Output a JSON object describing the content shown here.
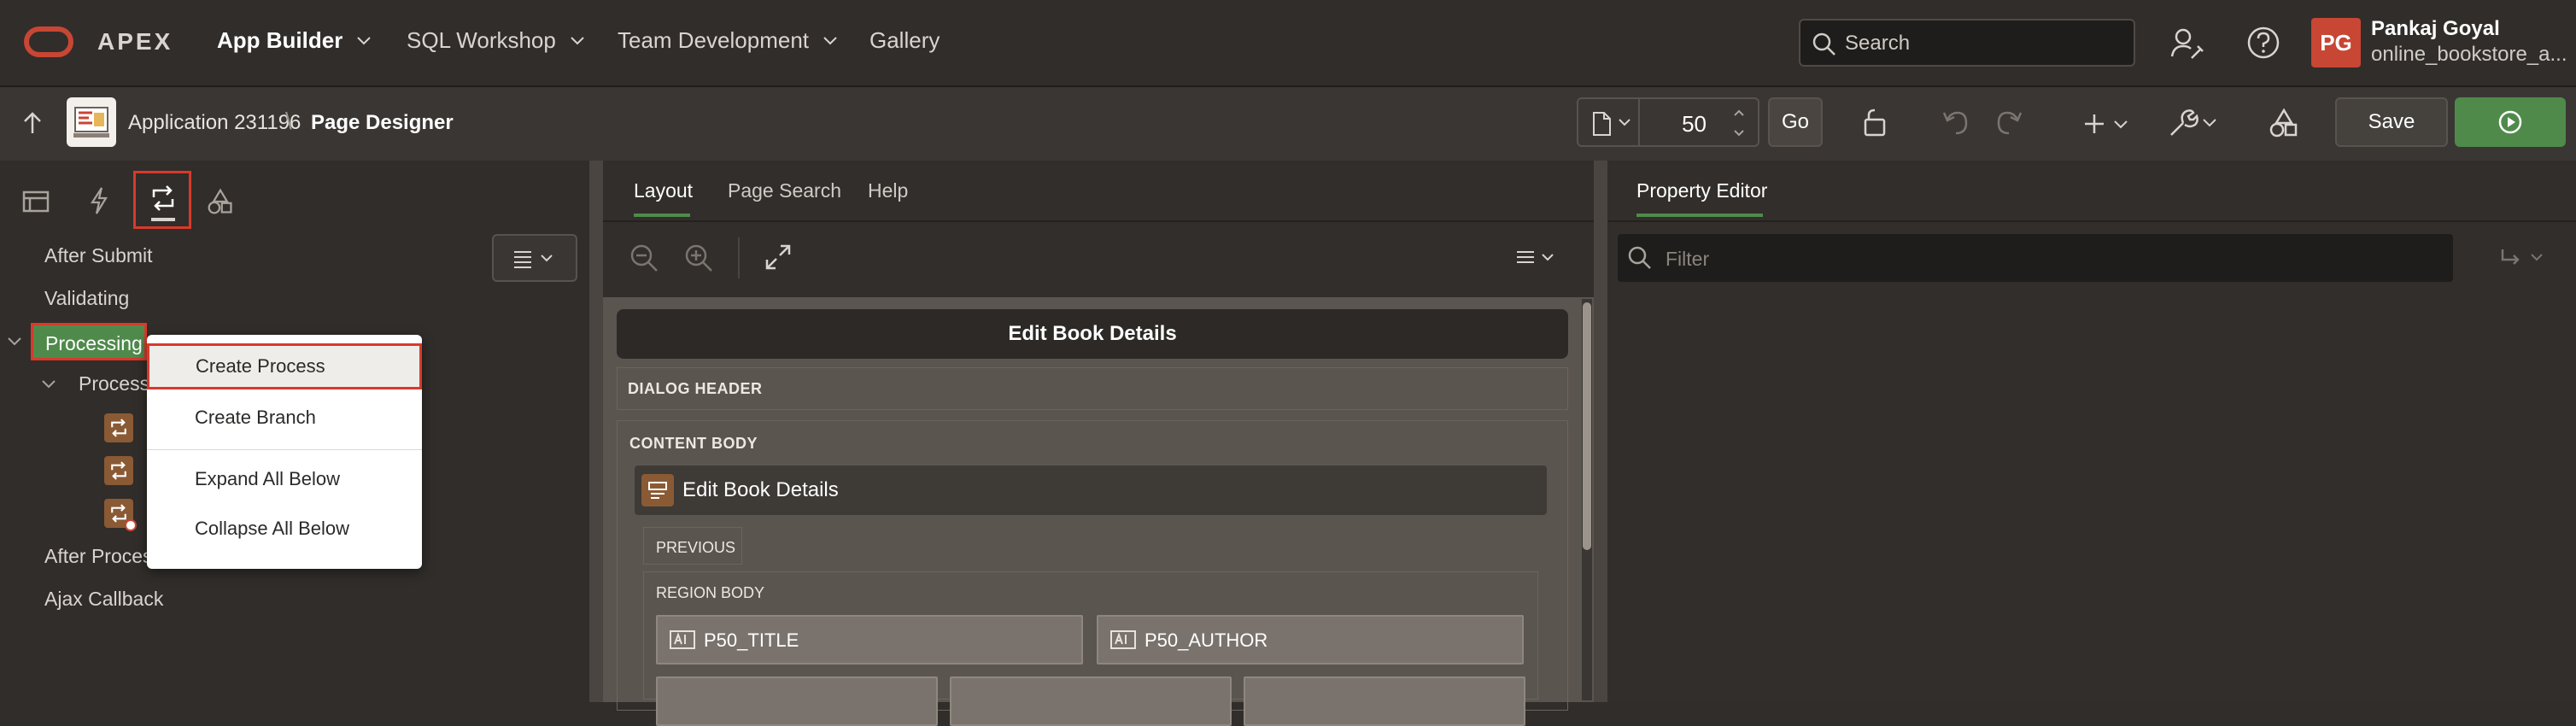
{
  "topnav": {
    "brand": "APEX",
    "items": [
      {
        "label": "App Builder",
        "active": true
      },
      {
        "label": "SQL Workshop"
      },
      {
        "label": "Team Development"
      },
      {
        "label": "Gallery"
      }
    ],
    "search_placeholder": "Search",
    "user": {
      "initials": "PG",
      "name": "Pankaj Goyal",
      "workspace": "online_bookstore_a..."
    }
  },
  "toolbar": {
    "app_label": "Application 231196",
    "separator": "\\",
    "page_label": "Page Designer",
    "page_number": "50",
    "go_label": "Go",
    "save_label": "Save"
  },
  "left_panel": {
    "menu_button_icon": "hamburger-icon",
    "tree": {
      "after_submit": "After Submit",
      "validating": "Validating",
      "processing": "Processing",
      "processes": "Processes",
      "after_processing": "After Processing",
      "ajax_callback": "Ajax Callback"
    }
  },
  "context_menu": {
    "items": [
      "Create Process",
      "Create Branch",
      "Expand All Below",
      "Collapse All Below"
    ]
  },
  "layout_panel": {
    "tabs": [
      {
        "label": "Layout",
        "active": true
      },
      {
        "label": "Page Search"
      },
      {
        "label": "Help"
      }
    ],
    "dialog_title": "Edit Book Details",
    "dialog_header": "DIALOG HEADER",
    "content_body": "CONTENT BODY",
    "region_title": "Edit Book Details",
    "previous": "PREVIOUS",
    "region_body": "REGION BODY",
    "items": [
      "P50_TITLE",
      "P50_AUTHOR"
    ]
  },
  "property_editor": {
    "tab": "Property Editor",
    "filter_placeholder": "Filter"
  },
  "colors": {
    "accent_green": "#4f8a4b",
    "highlight_red": "#d9392b",
    "brand_red": "#c74634"
  }
}
